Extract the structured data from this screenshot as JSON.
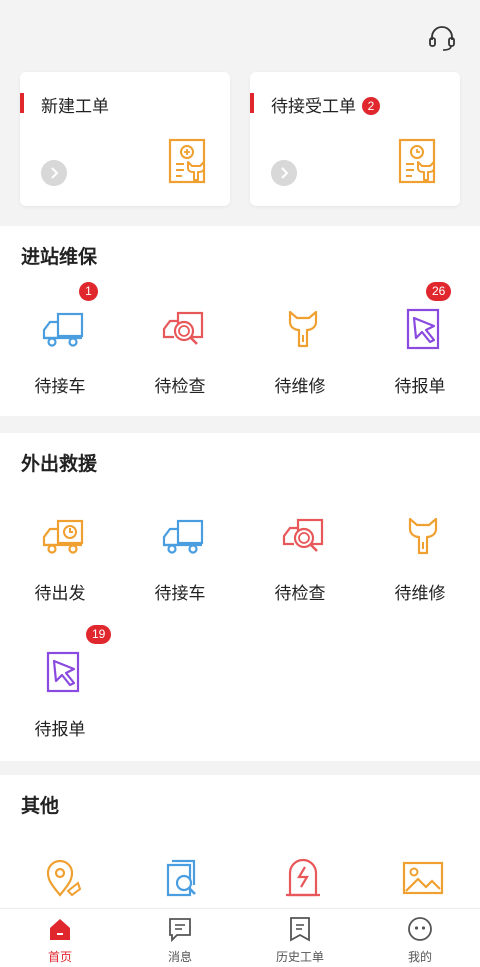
{
  "header": {
    "support_icon": "headset-icon"
  },
  "cards": [
    {
      "title": "新建工单",
      "badge": "",
      "icon": "new-order-icon"
    },
    {
      "title": "待接受工单",
      "badge": "2",
      "icon": "pending-order-icon"
    }
  ],
  "sections": [
    {
      "title": "进站维保",
      "items": [
        {
          "label": "待接车",
          "badge": "1",
          "icon": "truck-icon"
        },
        {
          "label": "待检查",
          "badge": "",
          "icon": "inspect-icon"
        },
        {
          "label": "待维修",
          "badge": "",
          "icon": "wrench-icon"
        },
        {
          "label": "待报单",
          "badge": "26",
          "icon": "report-icon"
        }
      ]
    },
    {
      "title": "外出救援",
      "items": [
        {
          "label": "待出发",
          "badge": "",
          "icon": "truck-clock-icon"
        },
        {
          "label": "待接车",
          "badge": "",
          "icon": "truck-icon"
        },
        {
          "label": "待检查",
          "badge": "",
          "icon": "inspect-icon"
        },
        {
          "label": "待维修",
          "badge": "",
          "icon": "wrench-icon"
        },
        {
          "label": "待报单",
          "badge": "19",
          "icon": "report-icon"
        }
      ]
    },
    {
      "title": "其他",
      "items": [
        {
          "icon": "location-icon"
        },
        {
          "icon": "doc-search-icon"
        },
        {
          "icon": "tombstone-icon"
        },
        {
          "icon": "image-icon"
        }
      ]
    }
  ],
  "tabbar": [
    {
      "label": "首页",
      "active": true
    },
    {
      "label": "消息",
      "active": false
    },
    {
      "label": "历史工单",
      "active": false
    },
    {
      "label": "我的",
      "active": false
    }
  ],
  "colors": {
    "accent": "#e0272d",
    "orange": "#f0a030",
    "blue": "#4a9ee0",
    "red": "#e8585a",
    "purple": "#8a4ae0"
  }
}
